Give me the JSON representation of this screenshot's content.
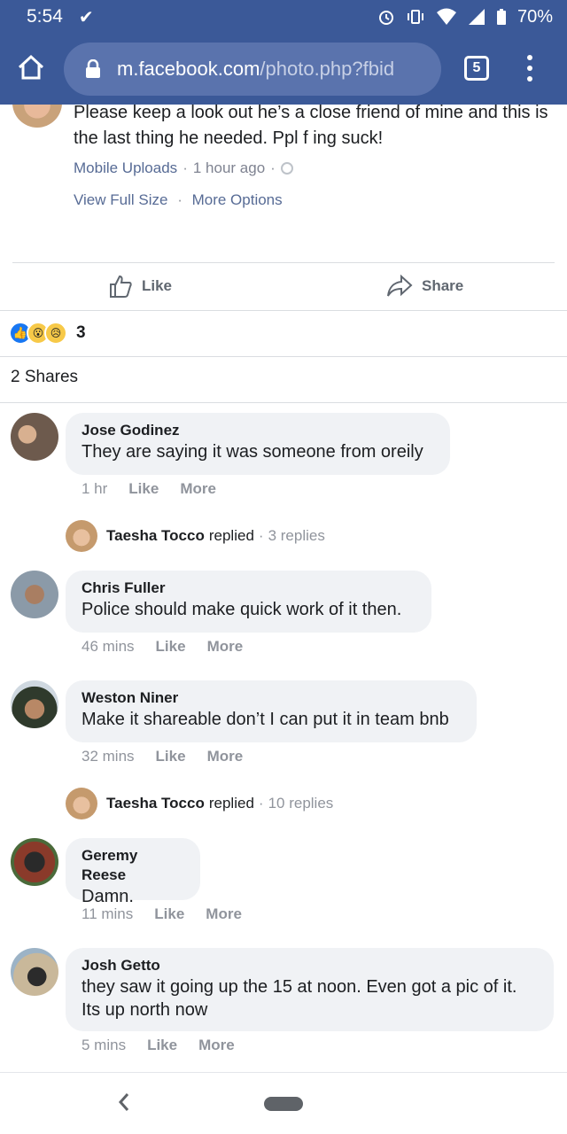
{
  "status_bar": {
    "time": "5:54",
    "download_icon": "check-download-icon",
    "battery": "70%"
  },
  "browser": {
    "url_host": "m.facebook.com",
    "url_path": "/photo.php?fbid",
    "tab_count": "5"
  },
  "post": {
    "caption": "Please keep a look out he’s a close friend of mine and this is the last thing he needed. Ppl f ing suck!",
    "album": "Mobile Uploads",
    "time": "1 hour ago",
    "view_full_size": "View Full Size",
    "more_options": "More Options",
    "like_label": "Like",
    "share_label": "Share",
    "reaction_count": "3",
    "shares_text": "2 Shares"
  },
  "comments": [
    {
      "name": "Jose Godinez",
      "text": "They are saying it was someone from oreily",
      "time": "1 hr",
      "like": "Like",
      "more": "More"
    },
    {
      "name": "Chris Fuller",
      "text": "Police should make quick work of it then.",
      "time": "46 mins",
      "like": "Like",
      "more": "More"
    },
    {
      "name": "Weston Niner",
      "text": "Make it shareable don’t I can put it in team bnb",
      "time": "32 mins",
      "like": "Like",
      "more": "More"
    },
    {
      "name": "Geremy Reese",
      "text": "Damn.",
      "time": "11 mins",
      "like": "Like",
      "more": "More"
    },
    {
      "name": "Josh Getto",
      "text": "they saw it going up the 15 at noon. Even got a pic of it. Its up north now",
      "time": "5 mins",
      "like": "Like",
      "more": "More"
    }
  ],
  "replies": [
    {
      "name": "Taesha Tocco",
      "action": "replied",
      "count": "3 replies"
    },
    {
      "name": "Taesha Tocco",
      "action": "replied",
      "count": "10 replies"
    }
  ],
  "colors": {
    "brand": "#3b5998",
    "link": "#576b95",
    "bubble": "#f0f2f5"
  }
}
